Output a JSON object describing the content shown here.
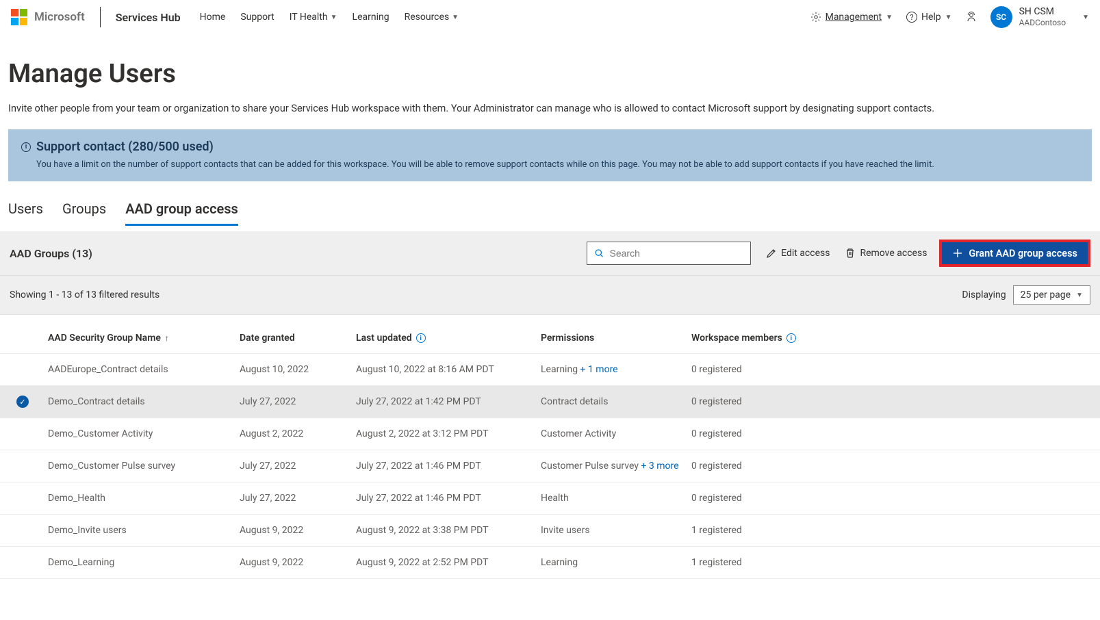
{
  "header": {
    "brand_name": "Microsoft",
    "app_name": "Services Hub",
    "nav": [
      "Home",
      "Support",
      "IT Health",
      "Learning",
      "Resources"
    ],
    "nav_has_dropdown": [
      false,
      false,
      true,
      false,
      true
    ],
    "management_label": "Management",
    "help_label": "Help",
    "avatar_initials": "SC",
    "user_name": "SH CSM",
    "tenant": "AADContoso"
  },
  "page": {
    "title": "Manage Users",
    "description": "Invite other people from your team or organization to share your Services Hub workspace with them. Your Administrator can manage who is allowed to contact Microsoft support by designating support contacts."
  },
  "banner": {
    "title": "Support contact (280/500 used)",
    "body": "You have a limit on the number of support contacts that can be added for this workspace. You will be able to remove support contacts while on this page. You may not be able to add support contacts if you have reached the limit."
  },
  "tabs": {
    "items": [
      "Users",
      "Groups",
      "AAD group access"
    ],
    "active_index": 2
  },
  "toolbar": {
    "group_count_label": "AAD Groups (13)",
    "search_placeholder": "Search",
    "edit_access_label": "Edit access",
    "remove_access_label": "Remove access",
    "grant_button_label": "Grant AAD group access"
  },
  "results": {
    "showing": "Showing 1 - 13 of 13 filtered results",
    "displaying_label": "Displaying",
    "page_size": "25 per page"
  },
  "columns": {
    "c1": "AAD Security Group Name",
    "c2": "Date granted",
    "c3": "Last updated",
    "c4": "Permissions",
    "c5": "Workspace members"
  },
  "rows": [
    {
      "selected": false,
      "name": "AADEurope_Contract details",
      "date": "August 10, 2022",
      "updated": "August 10, 2022 at 8:16 AM PDT",
      "perm": "Learning",
      "perm_more": "+ 1 more",
      "members": "0 registered"
    },
    {
      "selected": true,
      "name": "Demo_Contract details",
      "date": "July 27, 2022",
      "updated": "July 27, 2022 at 1:42 PM PDT",
      "perm": "Contract details",
      "perm_more": "",
      "members": "0 registered"
    },
    {
      "selected": false,
      "name": "Demo_Customer Activity",
      "date": "August 2, 2022",
      "updated": "August 2, 2022 at 3:12 PM PDT",
      "perm": "Customer Activity",
      "perm_more": "",
      "members": "0 registered"
    },
    {
      "selected": false,
      "name": "Demo_Customer Pulse survey",
      "date": "July 27, 2022",
      "updated": "July 27, 2022 at 1:46 PM PDT",
      "perm": "Customer Pulse survey",
      "perm_more": "+ 3 more",
      "members": "0 registered"
    },
    {
      "selected": false,
      "name": "Demo_Health",
      "date": "July 27, 2022",
      "updated": "July 27, 2022 at 1:46 PM PDT",
      "perm": "Health",
      "perm_more": "",
      "members": "0 registered"
    },
    {
      "selected": false,
      "name": "Demo_Invite users",
      "date": "August 9, 2022",
      "updated": "August 9, 2022 at 3:38 PM PDT",
      "perm": "Invite users",
      "perm_more": "",
      "members": "1 registered"
    },
    {
      "selected": false,
      "name": "Demo_Learning",
      "date": "August 9, 2022",
      "updated": "August 9, 2022 at 2:52 PM PDT",
      "perm": "Learning",
      "perm_more": "",
      "members": "1 registered"
    }
  ]
}
